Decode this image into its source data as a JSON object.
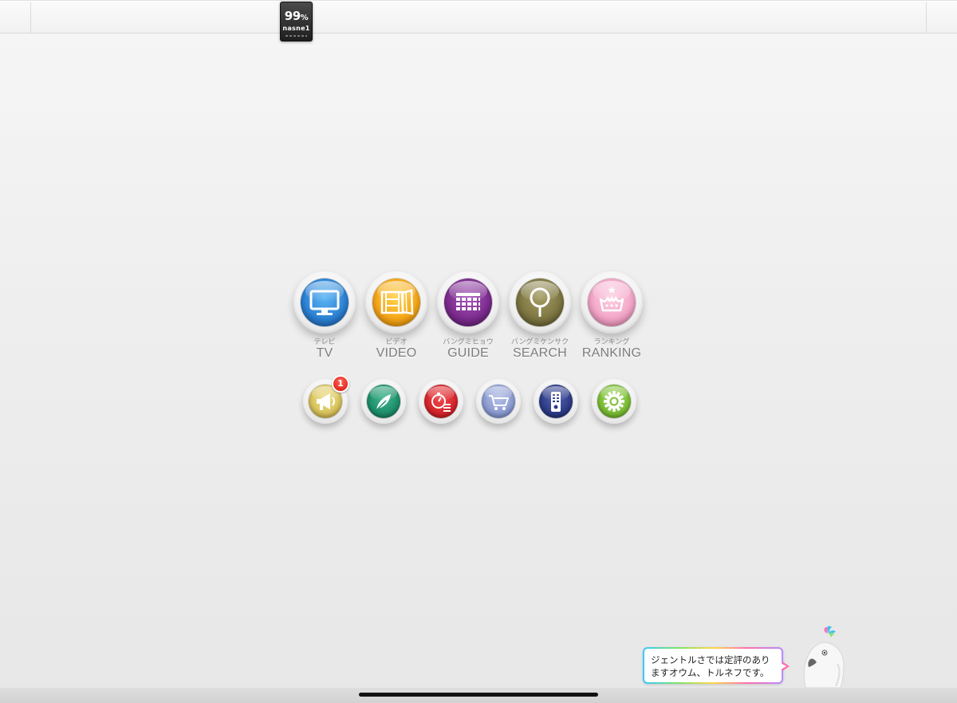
{
  "device": {
    "percent": "99",
    "percent_sign": "%",
    "name": "nasne1"
  },
  "main_menu": [
    {
      "kana": "テレビ",
      "label": "TV",
      "icon": "tv-icon",
      "color": "#2f86d6"
    },
    {
      "kana": "ビデオ",
      "label": "VIDEO",
      "icon": "film-icon",
      "color": "#f5a516"
    },
    {
      "kana": "バングミヒョウ",
      "label": "GUIDE",
      "icon": "grid-icon",
      "color": "#7a2a8c"
    },
    {
      "kana": "バングミケンサク",
      "label": "SEARCH",
      "icon": "magnifier-icon",
      "color": "#7b7440"
    },
    {
      "kana": "ランキング",
      "label": "RANKING",
      "icon": "crown-icon",
      "color": "#f3a3c6"
    }
  ],
  "sub_menu": [
    {
      "icon": "megaphone-icon",
      "color": "#d7c25a"
    },
    {
      "icon": "feather-icon",
      "color": "#1d8e6a"
    },
    {
      "icon": "timer-list-icon",
      "color": "#d3242a"
    },
    {
      "icon": "cart-icon",
      "color": "#8a9ad0"
    },
    {
      "icon": "remote-icon",
      "color": "#2d3a86"
    },
    {
      "icon": "gear-icon",
      "color": "#79bd33"
    }
  ],
  "notification_badge": "1",
  "mascot_message": {
    "line1": "ジェントルさでは定評のあり",
    "line2": "ますオウム、トルネフです。"
  }
}
